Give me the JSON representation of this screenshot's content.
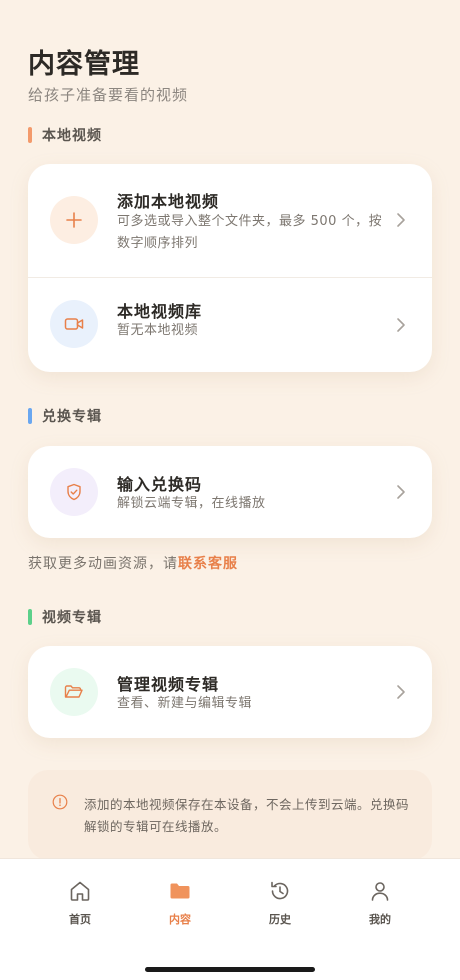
{
  "header": {
    "title": "内容管理",
    "subtitle": "给孩子准备要看的视频"
  },
  "sections": {
    "local": {
      "label": "本地视频",
      "accent": "#f39a6b",
      "items": [
        {
          "title": "添加本地视频",
          "subtitle": "可多选或导入整个文件夹，最多 500 个，按数字顺序排列",
          "icon": "plus-icon"
        },
        {
          "title": "本地视频库",
          "subtitle": "暂无本地视频",
          "icon": "video-camera-icon"
        }
      ]
    },
    "redeem": {
      "label": "兑换专辑",
      "accent": "#6aa7f0",
      "items": [
        {
          "title": "输入兑换码",
          "subtitle": "解锁云端专辑，在线播放",
          "icon": "shield-check-icon"
        }
      ]
    },
    "albums": {
      "label": "视频专辑",
      "accent": "#5cd08a",
      "items": [
        {
          "title": "管理视频专辑",
          "subtitle": "查看、新建与编辑专辑",
          "icon": "folder-open-icon"
        }
      ]
    }
  },
  "promo": {
    "text": "获取更多动画资源，请",
    "link": "联系客服"
  },
  "notice": {
    "text": "添加的本地视频保存在本设备，不会上传到云端。兑换码解锁的专辑可在线播放。",
    "icon": "info-icon"
  },
  "tabbar": {
    "active": "内容",
    "tabs": [
      {
        "label": "首页",
        "icon": "home-icon"
      },
      {
        "label": "内容",
        "icon": "folder-icon"
      },
      {
        "label": "历史",
        "icon": "history-icon"
      },
      {
        "label": "我的",
        "icon": "user-icon"
      }
    ]
  },
  "colors": {
    "background": "#fbf1e6",
    "accent_orange": "#e8804a",
    "text_primary": "#2d2a26",
    "text_secondary": "#7d7770"
  }
}
